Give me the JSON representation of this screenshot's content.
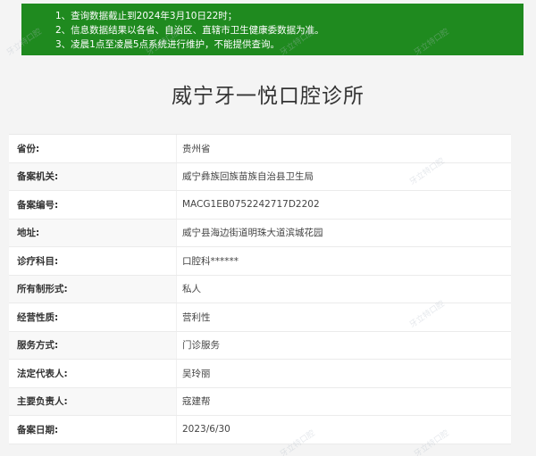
{
  "notice": {
    "lines": [
      "1、查询数据截止到2024年3月10日22时；",
      "2、信息数据结果以各省、自治区、直辖市卫生健康委数据为准。",
      "3、凌晨1点至凌晨5点系统进行维护，不能提供查询。"
    ]
  },
  "title": "威宁牙一悦口腔诊所",
  "rows": [
    {
      "label": "省份:",
      "value": "贵州省"
    },
    {
      "label": "备案机关:",
      "value": "威宁彝族回族苗族自治县卫生局"
    },
    {
      "label": "备案编号:",
      "value": "MACG1EB0752242717D2202"
    },
    {
      "label": "地址:",
      "value": "威宁县海边街道明珠大道滨城花园"
    },
    {
      "label": "诊疗科目:",
      "value": "口腔科******"
    },
    {
      "label": "所有制形式:",
      "value": "私人"
    },
    {
      "label": "经营性质:",
      "value": "营利性"
    },
    {
      "label": "服务方式:",
      "value": "门诊服务"
    },
    {
      "label": "法定代表人:",
      "value": "吴玲丽"
    },
    {
      "label": "主要负责人:",
      "value": "寇建帮"
    },
    {
      "label": "备案日期:",
      "value": "2023/6/30"
    }
  ],
  "watermark": "牙立特口腔"
}
